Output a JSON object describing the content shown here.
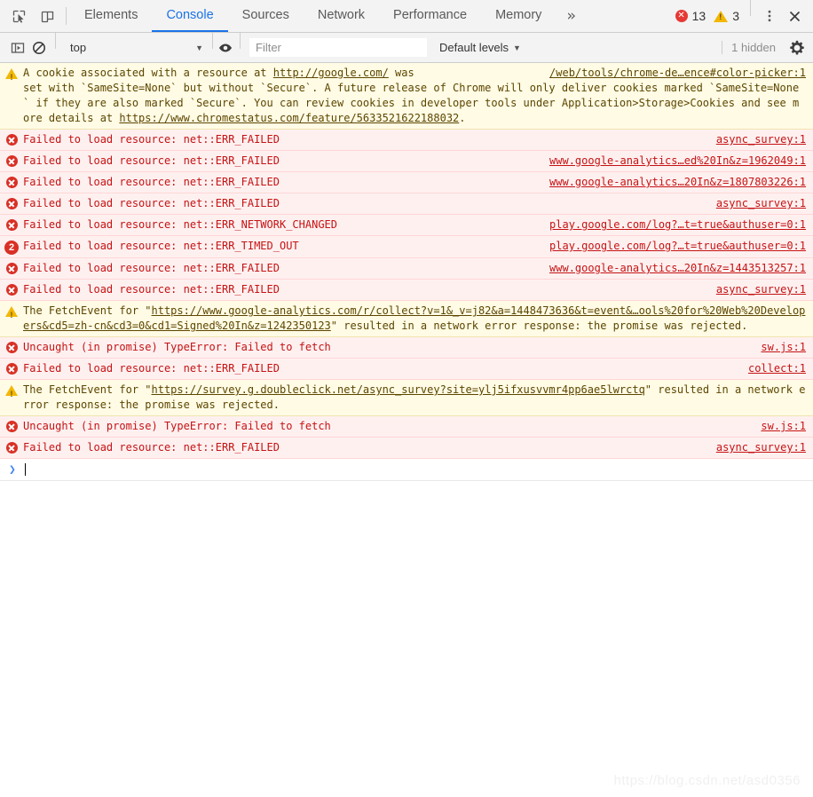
{
  "tabbar": {
    "inspect_icon": "inspect-element-icon",
    "device_icon": "device-toolbar-icon",
    "tabs": [
      {
        "label": "Elements",
        "active": false
      },
      {
        "label": "Console",
        "active": true
      },
      {
        "label": "Sources",
        "active": false
      },
      {
        "label": "Network",
        "active": false
      },
      {
        "label": "Performance",
        "active": false
      },
      {
        "label": "Memory",
        "active": false
      }
    ],
    "more_tabs_glyph": "»",
    "error_count": "13",
    "warning_count": "3",
    "menu_glyph": "⋮",
    "close_glyph": "✕",
    "error_color": "#d93025",
    "warning_color": "#f2b705",
    "accent_color": "#1a73e8"
  },
  "filterbar": {
    "sidebar_toggle_icon": "console-sidebar-icon",
    "clear_icon": "clear-console-icon",
    "context": "top",
    "caret": "▼",
    "eye_icon": "live-expression-icon",
    "filter_placeholder": "Filter",
    "filter_value": "",
    "levels_label": "Default levels",
    "hidden_label": "1 hidden",
    "settings_icon": "gear-icon"
  },
  "messages": [
    {
      "type": "warning",
      "icon": "warning-icon",
      "multiline": true,
      "parts": [
        {
          "t": "text",
          "v": "A cookie associated with a resource at "
        },
        {
          "t": "link",
          "v": "http://google.com/"
        },
        {
          "t": "text",
          "v": " was "
        }
      ],
      "continuation": "set with `SameSite=None` but without `Secure`. A future release of Chrome will only deliver cookies marked `SameSite=None` if they are also marked `Secure`. You can review cookies in developer tools under Application>Storage>Cookies and see more details at ",
      "tail_link": "https://www.chromestatus.com/feature/5633521622188032",
      "tail_text": ".",
      "source": "/web/tools/chrome-de…ence#color-picker:1"
    },
    {
      "type": "error",
      "icon": "error-icon",
      "text": "Failed to load resource: net::ERR_FAILED",
      "source": "async_survey:1"
    },
    {
      "type": "error",
      "icon": "error-icon",
      "text": "Failed to load resource: net::ERR_FAILED",
      "source": "www.google-analytics…ed%20In&z=1962049:1"
    },
    {
      "type": "error",
      "icon": "error-icon",
      "text": "Failed to load resource: net::ERR_FAILED",
      "source": "www.google-analytics…20In&z=1807803226:1"
    },
    {
      "type": "error",
      "icon": "error-icon",
      "text": "Failed to load resource: net::ERR_FAILED",
      "source": "async_survey:1"
    },
    {
      "type": "error",
      "icon": "error-icon",
      "text": "Failed to load resource: net::ERR_NETWORK_CHANGED",
      "source": "play.google.com/log?…t=true&authuser=0:1"
    },
    {
      "type": "error",
      "icon": "count-badge",
      "count": "2",
      "text": "Failed to load resource: net::ERR_TIMED_OUT",
      "source": "play.google.com/log?…t=true&authuser=0:1"
    },
    {
      "type": "error",
      "icon": "error-icon",
      "text": "Failed to load resource: net::ERR_FAILED",
      "source": "www.google-analytics…20In&z=1443513257:1"
    },
    {
      "type": "error",
      "icon": "error-icon",
      "text": "Failed to load resource: net::ERR_FAILED",
      "source": "async_survey:1"
    },
    {
      "type": "warning",
      "icon": "warning-icon",
      "multiline": true,
      "prefix": "The FetchEvent for \"",
      "link": "https://www.google-analytics.com/r/collect?v=1&_v=j82&a=1448473636&t=event&…ools%20for%20Web%20Developers&cd5=zh-cn&cd3=0&cd1=Signed%20In&z=1242350123",
      "suffix": "\" resulted in a network error response: the promise was rejected.",
      "source": ""
    },
    {
      "type": "error",
      "icon": "error-icon",
      "text": "Uncaught (in promise) TypeError: Failed to fetch",
      "source": "sw.js:1"
    },
    {
      "type": "error",
      "icon": "error-icon",
      "text": "Failed to load resource: net::ERR_FAILED",
      "source": "collect:1"
    },
    {
      "type": "warning",
      "icon": "warning-icon",
      "multiline": true,
      "prefix": "The FetchEvent for \"",
      "link": "https://survey.g.doubleclick.net/async_survey?site=ylj5ifxusvvmr4pp6ae5lwrctq",
      "suffix": "\" resulted in a network error response: the promise was rejected.",
      "source": ""
    },
    {
      "type": "error",
      "icon": "error-icon",
      "text": "Uncaught (in promise) TypeError: Failed to fetch",
      "source": "sw.js:1"
    },
    {
      "type": "error",
      "icon": "error-icon",
      "text": "Failed to load resource: net::ERR_FAILED",
      "source": "async_survey:1"
    }
  ],
  "prompt": {
    "arrow": "❯",
    "value": ""
  },
  "watermark": "https://blog.csdn.net/asd0356"
}
